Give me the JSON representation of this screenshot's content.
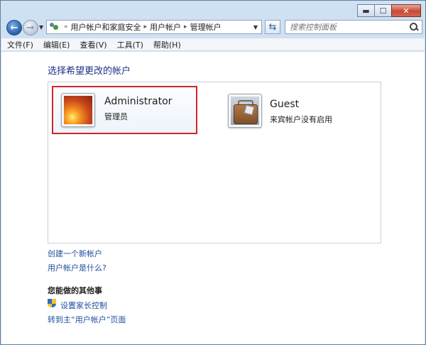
{
  "window": {
    "caption": {
      "minimize": "▬",
      "maximize": "☐",
      "close": "✕"
    }
  },
  "nav": {
    "back": "←",
    "forward": "→",
    "address": {
      "crumb_chevrons": "«",
      "segments": [
        "用户帐户和家庭安全",
        "用户帐户",
        "管理帐户"
      ],
      "separator": "▸"
    },
    "search_placeholder": "搜索控制面板"
  },
  "menubar": {
    "items": [
      "文件(F)",
      "编辑(E)",
      "查看(V)",
      "工具(T)",
      "帮助(H)"
    ]
  },
  "main": {
    "heading": "选择希望更改的帐户",
    "accounts": [
      {
        "name": "Administrator",
        "role": "管理员",
        "selected": true,
        "icon": "orange-flower-picture"
      },
      {
        "name": "Guest",
        "role": "来宾帐户没有启用",
        "selected": false,
        "icon": "briefcase-picture"
      }
    ],
    "links": {
      "create_account": "创建一个新帐户",
      "what_is_account": "用户帐户是什么?"
    },
    "other_tasks": {
      "heading": "您能做的其他事",
      "parental_controls": "设置家长控制",
      "go_main": "转到主“用户帐户”页面"
    }
  },
  "colors": {
    "selection_border": "#d0262b",
    "link": "#1f4e9e",
    "heading": "#1e3287"
  }
}
